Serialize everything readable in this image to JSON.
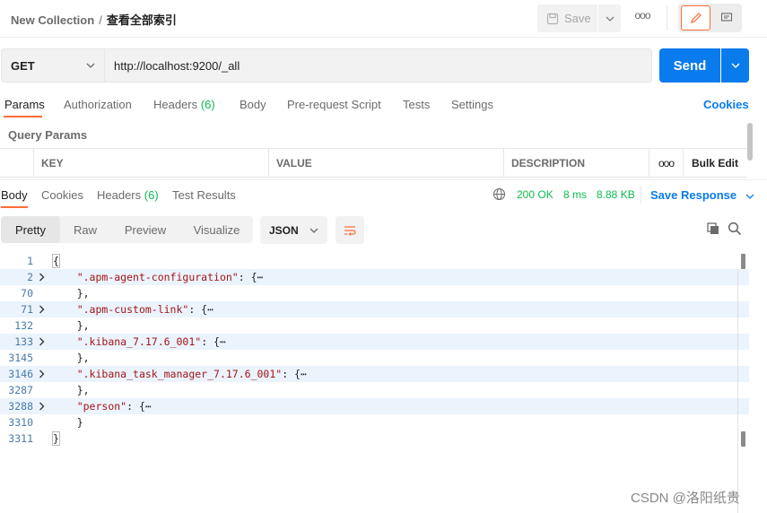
{
  "header": {
    "collection": "New Collection",
    "separator": "/",
    "request_name": "查看全部索引",
    "save_label": "Save",
    "more": "ooo"
  },
  "request": {
    "method": "GET",
    "url": "http://localhost:9200/_all",
    "send_label": "Send"
  },
  "request_tabs": [
    {
      "label": "Params"
    },
    {
      "label": "Authorization"
    },
    {
      "label": "Headers",
      "count": "(6)"
    },
    {
      "label": "Body"
    },
    {
      "label": "Pre-request Script"
    },
    {
      "label": "Tests"
    },
    {
      "label": "Settings"
    }
  ],
  "cookies_link": "Cookies",
  "query_params": {
    "title": "Query Params",
    "columns": [
      "KEY",
      "VALUE",
      "DESCRIPTION"
    ],
    "more": "ooo",
    "bulk_edit": "Bulk Edit"
  },
  "response_tabs": [
    {
      "label": "Body"
    },
    {
      "label": "Cookies"
    },
    {
      "label": "Headers",
      "count": "(6)"
    },
    {
      "label": "Test Results"
    }
  ],
  "response_status": {
    "status": "200 OK",
    "time": "8 ms",
    "size": "8.88 KB",
    "save_response": "Save Response"
  },
  "view_modes": [
    "Pretty",
    "Raw",
    "Preview",
    "Visualize"
  ],
  "format": "JSON",
  "code_lines": [
    {
      "num": "1",
      "text": "{",
      "fold": false,
      "hl": false
    },
    {
      "num": "2",
      "key": "\".apm-agent-configuration\"",
      "rest": ": {",
      "ellipsis": "⋯",
      "fold": true,
      "hl": true
    },
    {
      "num": "70",
      "text": "    },",
      "fold": false,
      "hl": false
    },
    {
      "num": "71",
      "key": "\".apm-custom-link\"",
      "rest": ": {",
      "ellipsis": "⋯",
      "fold": true,
      "hl": true
    },
    {
      "num": "132",
      "text": "    },",
      "fold": false,
      "hl": false
    },
    {
      "num": "133",
      "key": "\".kibana_7.17.6_001\"",
      "rest": ": {",
      "ellipsis": "⋯",
      "fold": true,
      "hl": true
    },
    {
      "num": "3145",
      "text": "    },",
      "fold": false,
      "hl": false
    },
    {
      "num": "3146",
      "key": "\".kibana_task_manager_7.17.6_001\"",
      "rest": ": {",
      "ellipsis": "⋯",
      "fold": true,
      "hl": true
    },
    {
      "num": "3287",
      "text": "    },",
      "fold": false,
      "hl": false
    },
    {
      "num": "3288",
      "key": "\"person\"",
      "rest": ": {",
      "ellipsis": "⋯",
      "fold": true,
      "hl": true
    },
    {
      "num": "3310",
      "text": "    }",
      "fold": false,
      "hl": false
    },
    {
      "num": "3311",
      "text": "}",
      "fold": false,
      "hl": false
    }
  ],
  "watermark": "CSDN @洛阳纸贵",
  "colors": {
    "accent_orange": "#ff6c37",
    "primary_blue": "#097bed",
    "status_green": "#0cbb52",
    "json_key": "#a31515"
  }
}
